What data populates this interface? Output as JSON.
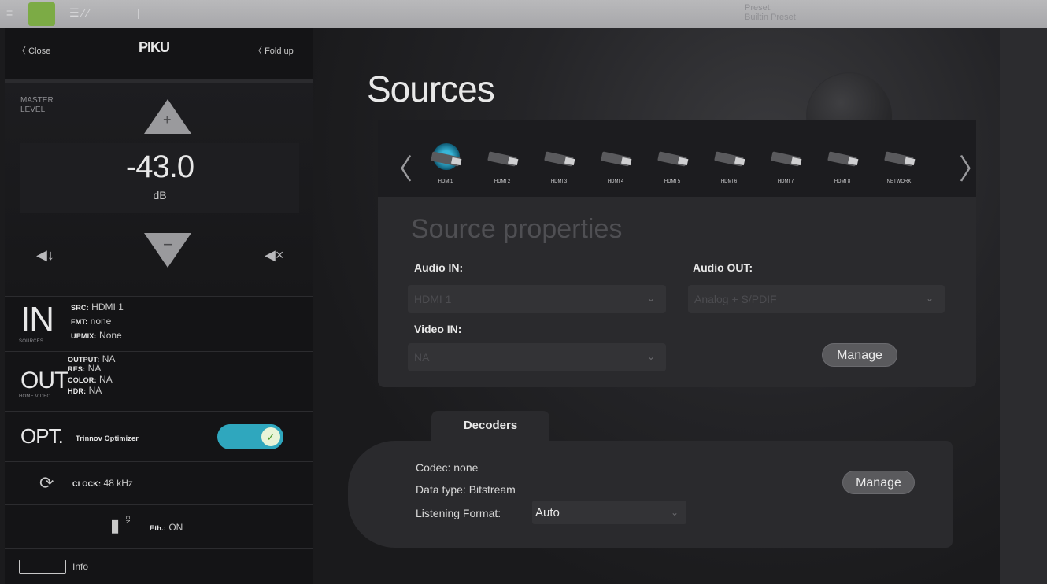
{
  "toolbar": {
    "preset_line1": "Preset:",
    "preset_line2": "Builtin Preset"
  },
  "left_panel": {
    "close_label": "Close",
    "foldup_label": "Fold up",
    "brand": "PIKU",
    "master_label": "MASTER LEVEL",
    "level_value": "-43.0",
    "level_unit": "dB",
    "vol_up_symbol": "+",
    "vol_down_symbol": "−",
    "in": {
      "big": "IN",
      "sub": "SOURCES",
      "src_key": "SRC:",
      "src_val": "HDMI 1",
      "fmt_key": "FMT:",
      "fmt_val": "none",
      "upmix_key": "UPMIX:",
      "upmix_val": "None"
    },
    "out": {
      "big": "OUT",
      "sub": "HOME VIDEO",
      "output_key": "OUTPUT:",
      "output_val": "NA",
      "res_key": "RES:",
      "res_val": "NA",
      "color_key": "COLOR:",
      "color_val": "NA",
      "hdr_key": "HDR:",
      "hdr_val": "NA"
    },
    "opt": {
      "big": "OPT.",
      "label": "Trinnov Optimizer",
      "enabled": true
    },
    "clock": {
      "key": "CLOCK:",
      "val": "48 kHz"
    },
    "eth": {
      "key": "Eth.:",
      "val": "ON",
      "side": "ON"
    },
    "info_label": "Info"
  },
  "main": {
    "title": "Sources",
    "sources": [
      {
        "label": "HDMI1",
        "active": true
      },
      {
        "label": "HDMI 2",
        "active": false
      },
      {
        "label": "HDMI 3",
        "active": false
      },
      {
        "label": "HDMI 4",
        "active": false
      },
      {
        "label": "HDMI 5",
        "active": false
      },
      {
        "label": "HDMI 6",
        "active": false
      },
      {
        "label": "HDMI 7",
        "active": false
      },
      {
        "label": "HDMI 8",
        "active": false
      },
      {
        "label": "NETWORK",
        "active": false
      }
    ],
    "props": {
      "title": "Source properties",
      "audio_in_label": "Audio IN:",
      "audio_in_value": "HDMI 1",
      "audio_out_label": "Audio OUT:",
      "audio_out_value": "Analog + S/PDIF",
      "video_in_label": "Video IN:",
      "video_in_value": "NA",
      "manage_label": "Manage"
    },
    "decoders": {
      "tab_label": "Decoders",
      "codec": "Codec: none",
      "data_type": "Data type: Bitstream",
      "listening_label": "Listening Format:",
      "listening_value": "Auto",
      "manage_label": "Manage"
    }
  },
  "colors": {
    "accent_cyan": "#2fa7be",
    "toolbar_green": "#7cab45"
  }
}
